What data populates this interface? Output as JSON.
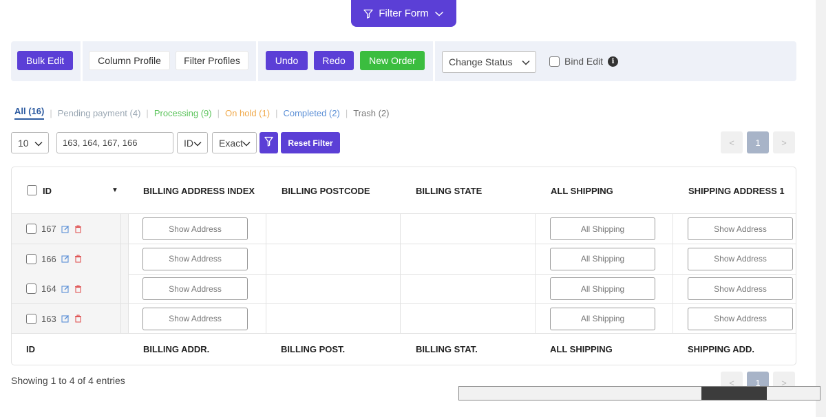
{
  "filter_form": {
    "label": "Filter Form"
  },
  "toolbar": {
    "bulk_edit": "Bulk Edit",
    "column_profile": "Column Profile",
    "filter_profiles": "Filter Profiles",
    "undo": "Undo",
    "redo": "Redo",
    "new_order": "New Order",
    "change_status": "Change Status",
    "bind_edit": "Bind Edit"
  },
  "status_tabs": [
    {
      "label": "All (16)",
      "color": "#2c5aa0"
    },
    {
      "label": "Pending payment (4)",
      "color": "#9aa7b3"
    },
    {
      "label": "Processing (9)",
      "color": "#5cc45c"
    },
    {
      "label": "On hold (1)",
      "color": "#f0a94a"
    },
    {
      "label": "Completed (2)",
      "color": "#5b8fd6"
    },
    {
      "label": "Trash (2)",
      "color": "#777777"
    }
  ],
  "filter_row": {
    "per_page": "10",
    "search_value": "163, 164, 167, 166",
    "field": "ID",
    "match": "Exact",
    "reset": "Reset Filter"
  },
  "pagination": {
    "prev": "<",
    "current": "1",
    "next": ">"
  },
  "table": {
    "headers": [
      "ID",
      "BILLING ADDRESS INDEX",
      "BILLING POSTCODE",
      "BILLING STATE",
      "ALL SHIPPING",
      "SHIPPING ADDRESS 1"
    ],
    "footers": [
      "ID",
      "BILLING ADDR.",
      "BILLING POST.",
      "BILLING STAT.",
      "ALL SHIPPING",
      "SHIPPING ADD."
    ],
    "rows": [
      {
        "id": "167",
        "billing_address": "Show Address",
        "all_shipping": "All Shipping",
        "shipping_address": "Show Address"
      },
      {
        "id": "166",
        "billing_address": "Show Address",
        "all_shipping": "All Shipping",
        "shipping_address": "Show Address"
      },
      {
        "id": "164",
        "billing_address": "Show Address",
        "all_shipping": "All Shipping",
        "shipping_address": "Show Address"
      },
      {
        "id": "163",
        "billing_address": "Show Address",
        "all_shipping": "All Shipping",
        "shipping_address": "Show Address"
      }
    ]
  },
  "summary": "Showing 1 to 4 of 4 entries",
  "colors": {
    "accent": "#5b3fd6",
    "success": "#3bbd3f",
    "toolbar_bg": "#eef1f8"
  }
}
